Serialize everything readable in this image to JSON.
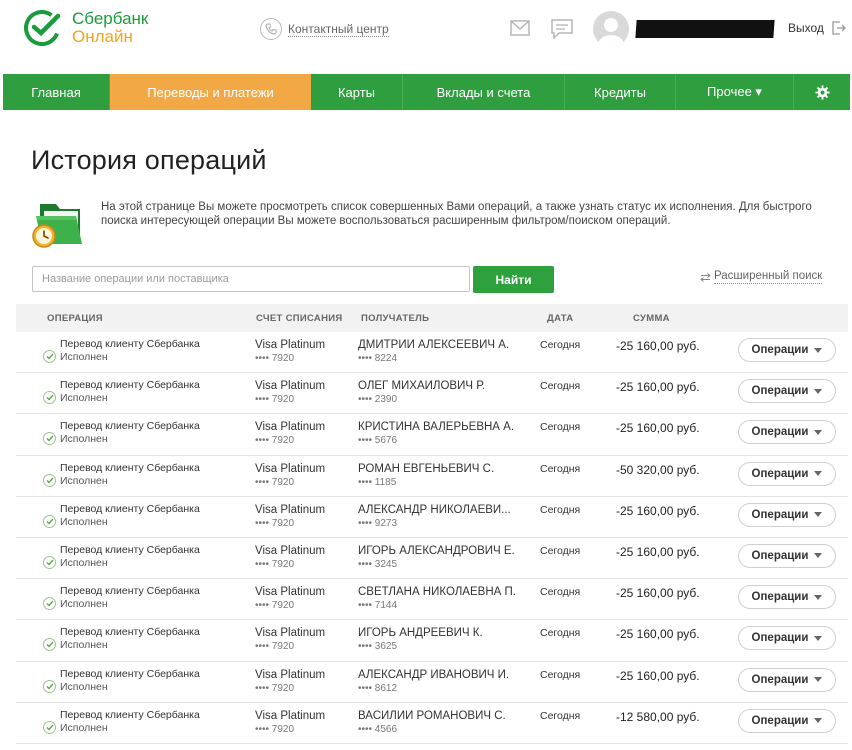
{
  "brand": {
    "line1": "Сбербанк",
    "line2": "Онлайн"
  },
  "header": {
    "contact_label": "Контактный центр",
    "logout_label": "Выход"
  },
  "nav": [
    {
      "label": "Главная",
      "active": false
    },
    {
      "label": "Переводы и платежи",
      "active": true
    },
    {
      "label": "Карты",
      "active": false
    },
    {
      "label": "Вклады и счета",
      "active": false
    },
    {
      "label": "Кредиты",
      "active": false
    },
    {
      "label": "Прочее ▾",
      "active": false
    }
  ],
  "page": {
    "title": "История операций",
    "intro": "На этой странице Вы можете просмотреть список совершенных Вами операций, а также узнать статус их исполнения. Для быстрого поиска интересующей операции Вы можете воспользоваться расширенным фильтром/поиском операций."
  },
  "search": {
    "placeholder": "Название операции или поставщика",
    "value": "",
    "button_label": "Найти",
    "advanced_label": "Расширенный поиск"
  },
  "table": {
    "columns": [
      "ОПЕРАЦИЯ",
      "СЧЕТ СПИСАНИЯ",
      "ПОЛУЧАТЕЛЬ",
      "ДАТА",
      "СУММА"
    ],
    "action_label": "Операции",
    "rows": [
      {
        "op": "Перевод клиенту Сбербанка",
        "status": "Исполнен",
        "account": "Visa Platinum",
        "account_num": "•••• 7920",
        "recipient": "ДМИТРИЙ АЛЕКСЕЕВИЧ А.",
        "recipient_num": "•••• 8224",
        "date": "Сегодня",
        "amount": "-25 160,00 руб."
      },
      {
        "op": "Перевод клиенту Сбербанка",
        "status": "Исполнен",
        "account": "Visa Platinum",
        "account_num": "•••• 7920",
        "recipient": "ОЛЕГ МИХАЙЛОВИЧ Р.",
        "recipient_num": "•••• 2390",
        "date": "Сегодня",
        "amount": "-25 160,00 руб."
      },
      {
        "op": "Перевод клиенту Сбербанка",
        "status": "Исполнен",
        "account": "Visa Platinum",
        "account_num": "•••• 7920",
        "recipient": "КРИСТИНА ВАЛЕРЬЕВНА А.",
        "recipient_num": "•••• 5676",
        "date": "Сегодня",
        "amount": "-25 160,00 руб."
      },
      {
        "op": "Перевод клиенту Сбербанка",
        "status": "Исполнен",
        "account": "Visa Platinum",
        "account_num": "•••• 7920",
        "recipient": "РОМАН ЕВГЕНЬЕВИЧ С.",
        "recipient_num": "•••• 1185",
        "date": "Сегодня",
        "amount": "-50 320,00 руб."
      },
      {
        "op": "Перевод клиенту Сбербанка",
        "status": "Исполнен",
        "account": "Visa Platinum",
        "account_num": "•••• 7920",
        "recipient": "АЛЕКСАНДР НИКОЛАЕВИ...",
        "recipient_num": "•••• 9273",
        "date": "Сегодня",
        "amount": "-25 160,00 руб."
      },
      {
        "op": "Перевод клиенту Сбербанка",
        "status": "Исполнен",
        "account": "Visa Platinum",
        "account_num": "•••• 7920",
        "recipient": "ИГОРЬ АЛЕКСАНДРОВИЧ Е.",
        "recipient_num": "•••• 3245",
        "date": "Сегодня",
        "amount": "-25 160,00 руб."
      },
      {
        "op": "Перевод клиенту Сбербанка",
        "status": "Исполнен",
        "account": "Visa Platinum",
        "account_num": "•••• 7920",
        "recipient": "СВЕТЛАНА НИКОЛАЕВНА П.",
        "recipient_num": "•••• 7144",
        "date": "Сегодня",
        "amount": "-25 160,00 руб."
      },
      {
        "op": "Перевод клиенту Сбербанка",
        "status": "Исполнен",
        "account": "Visa Platinum",
        "account_num": "•••• 7920",
        "recipient": "ИГОРЬ АНДРЕЕВИЧ К.",
        "recipient_num": "•••• 3625",
        "date": "Сегодня",
        "amount": "-25 160,00 руб."
      },
      {
        "op": "Перевод клиенту Сбербанка",
        "status": "Исполнен",
        "account": "Visa Platinum",
        "account_num": "•••• 7920",
        "recipient": "АЛЕКСАНДР ИВАНОВИЧ И.",
        "recipient_num": "•••• 8612",
        "date": "Сегодня",
        "amount": "-25 160,00 руб."
      },
      {
        "op": "Перевод клиенту Сбербанка",
        "status": "Исполнен",
        "account": "Visa Platinum",
        "account_num": "•••• 7920",
        "recipient": "ВАСИЛИЙ РОМАНОВИЧ С.",
        "recipient_num": "•••• 4566",
        "date": "Сегодня",
        "amount": "-12 580,00 руб."
      }
    ]
  },
  "icons": {
    "logo": "sberbank-logo-icon",
    "contact": "phone-icon",
    "mail": "mail-icon",
    "chat": "chat-icon",
    "logout": "logout-icon",
    "settings": "gear-icon",
    "folder": "folder-clock-icon",
    "advanced": "filter-arrows-icon",
    "status": "check-icon",
    "menu": "chevron-down-icon"
  },
  "colors": {
    "brand_green": "#2f9e3f",
    "active_tab": "#f2a844",
    "logo_orange": "#f2a41d"
  }
}
